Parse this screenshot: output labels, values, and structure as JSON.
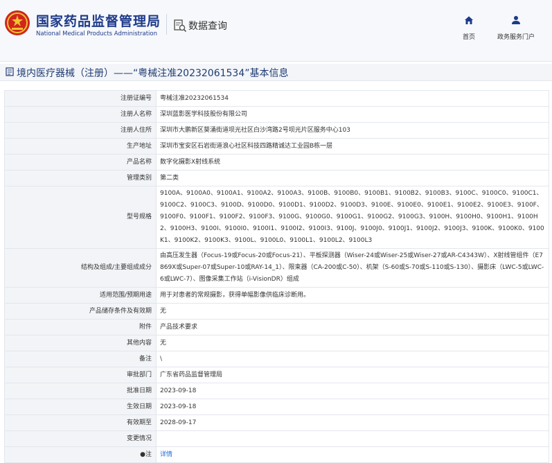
{
  "header": {
    "site_name_cn": "国家药品监督管理局",
    "site_name_en": "National Medical Products Administration",
    "data_query_label": "数据查询",
    "nav": [
      {
        "label": "首页"
      },
      {
        "label": "政务服务门户"
      }
    ]
  },
  "page": {
    "title": "境内医疗器械（注册）——“粤械注准20232061534”基本信息"
  },
  "rows": [
    {
      "label": "注册证编号",
      "value": "粤械注准20232061534"
    },
    {
      "label": "注册人名称",
      "value": "深圳蓝影医学科技股份有限公司"
    },
    {
      "label": "注册人住所",
      "value": "深圳市大鹏新区葵涌街道坝光社区白沙湾路2号坝光片区服务中心103"
    },
    {
      "label": "生产地址",
      "value": "深圳市宝安区石岩街道浪心社区科技四路精诚达工业园B栋一层"
    },
    {
      "label": "产品名称",
      "value": "数字化摄影X射线系统"
    },
    {
      "label": "管理类别",
      "value": "第二类"
    },
    {
      "label": "型号规格",
      "value": "9100A、9100A0、9100A1、9100A2、9100A3、9100B、9100B0、9100B1、9100B2、9100B3、9100C、9100C0、9100C1、9100C2、9100C3、9100D、9100D0、9100D1、9100D2、9100D3、9100E、9100E0、9100E1、9100E2、9100E3、9100F、9100F0、9100F1、9100F2、9100F3、9100G、9100G0、9100G1、9100G2、9100G3、9100H、9100H0、9100H1、9100H2、9100H3、9100I、9100I0、9100I1、9100I2、9100I3、9100J、9100J0、9100J1、9100J2、9100J3、9100K、9100K0、9100K1、9100K2、9100K3、9100L、9100L0、9100L1、9100L2、9100L3"
    },
    {
      "label": "结构及组成/主要组成成分",
      "value": "由高压发生器（Focus-19或Focus-20或Focus-21）、平板探测器（Wiser-24或Wiser-25或Wiser-27或AR-C4343W）、X射线管组件（E7869X或Super-07或Super-10或RAY-14_1）、限束器（CA-200或C-50）、机架（S-60或S-70或S-110或S-130）、摄影床（LWC-5或LWC-6或LWC-7）、图像采集工作站（i-VisionDR）组成"
    },
    {
      "label": "适用范围/预期用途",
      "value": "用于对患者的常规摄影，获得单幅影像供临床诊断用。"
    },
    {
      "label": "产品储存条件及有效期",
      "value": "无"
    },
    {
      "label": "附件",
      "value": "产品技术要求"
    },
    {
      "label": "其他内容",
      "value": "无"
    },
    {
      "label": "备注",
      "value": "\\"
    },
    {
      "label": "审批部门",
      "value": "广东省药品监督管理局"
    },
    {
      "label": "批准日期",
      "value": "2023-09-18"
    },
    {
      "label": "生效日期",
      "value": "2023-09-18"
    },
    {
      "label": "有效期至",
      "value": "2028-09-17"
    },
    {
      "label": "变更情况",
      "value": ""
    },
    {
      "label": "注",
      "value": "详情",
      "is_link": true
    }
  ],
  "icons": {
    "emblem": "national-emblem-icon",
    "query": "magnifier-document-icon",
    "home": "home-icon",
    "portal": "user-icon",
    "title": "document-icon",
    "note": "bullet-icon"
  },
  "colors": {
    "brand": "#1e3a8a",
    "emblem_red": "#d0261d",
    "emblem_gold": "#f2c230",
    "link": "#1a6ad6",
    "label_bg": "#f2f4f7"
  }
}
